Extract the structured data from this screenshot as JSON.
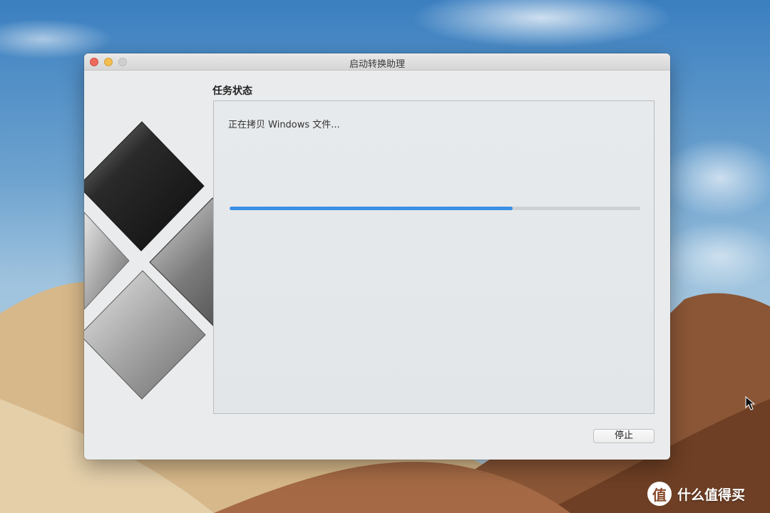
{
  "window": {
    "title": "启动转换助理"
  },
  "panel": {
    "section_title": "任务状态",
    "status_text": "正在拷贝 Windows 文件...",
    "progress": 0.69
  },
  "buttons": {
    "stop_label": "停止"
  },
  "watermark": {
    "badge": "值",
    "text": "什么值得买"
  },
  "colors": {
    "progress_fill": "#3a8ee6",
    "close": "#ec6a5e",
    "minimize": "#f4bf4f"
  }
}
